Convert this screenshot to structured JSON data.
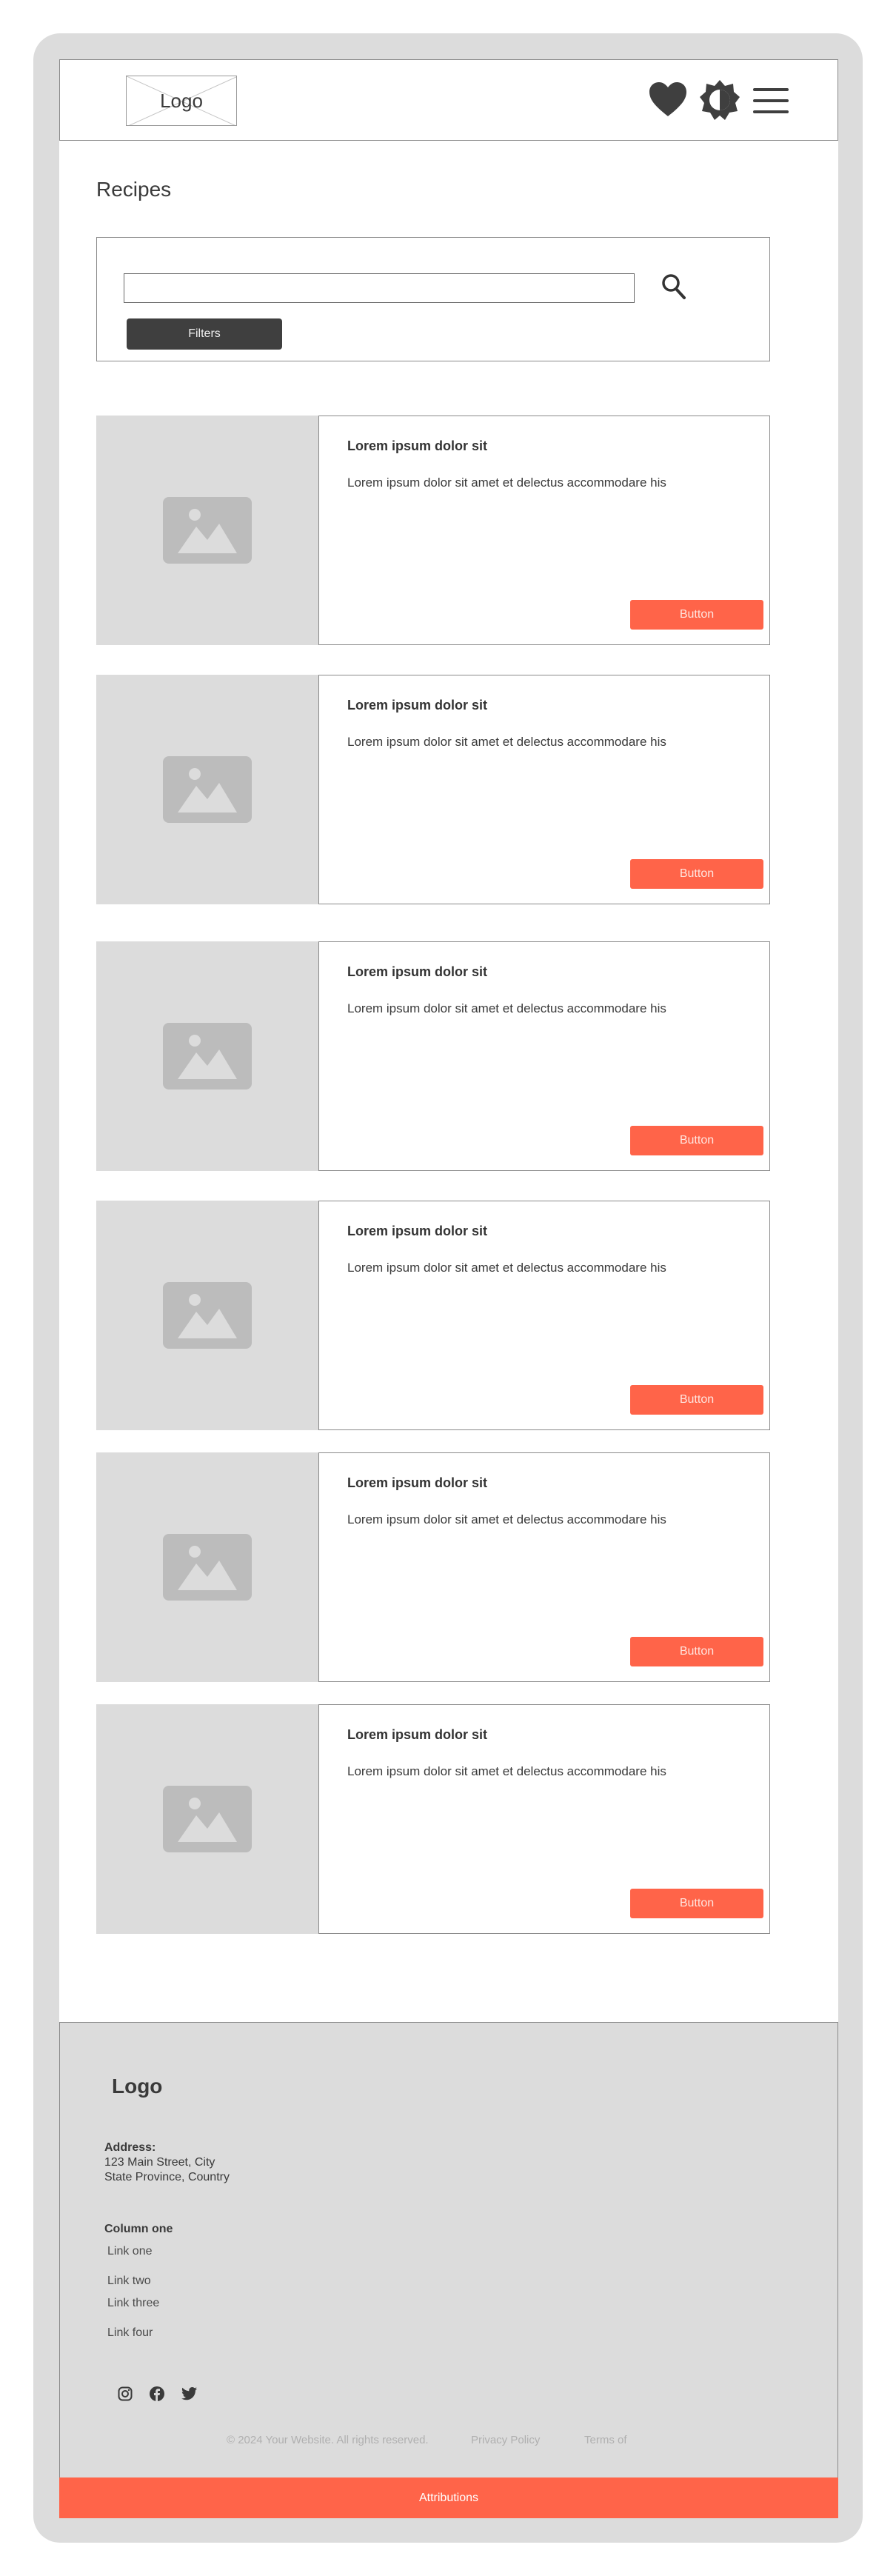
{
  "header": {
    "logo": "Logo",
    "icons": [
      "heart-icon",
      "theme-toggle-icon",
      "menu-icon"
    ]
  },
  "main": {
    "title": "Recipes",
    "search": {
      "value": "",
      "placeholder": ""
    },
    "filters_label": "Filters",
    "cards": [
      {
        "title": "Lorem ipsum dolor sit",
        "text": "Lorem ipsum dolor sit amet et delectus accommodare his",
        "button": "Button"
      },
      {
        "title": "Lorem ipsum dolor sit",
        "text": "Lorem ipsum dolor sit amet et delectus accommodare his",
        "button": "Button"
      },
      {
        "title": "Lorem ipsum dolor sit",
        "text": "Lorem ipsum dolor sit amet et delectus accommodare his",
        "button": "Button"
      },
      {
        "title": "Lorem ipsum dolor sit",
        "text": "Lorem ipsum dolor sit amet et delectus accommodare his",
        "button": "Button"
      },
      {
        "title": "Lorem ipsum dolor sit",
        "text": "Lorem ipsum dolor sit amet et delectus accommodare his",
        "button": "Button"
      },
      {
        "title": "Lorem ipsum dolor sit",
        "text": "Lorem ipsum dolor sit amet et delectus accommodare his",
        "button": "Button"
      }
    ]
  },
  "footer": {
    "logo": "Logo",
    "address_label": "Address:",
    "address_line1": "123 Main Street, City",
    "address_line2": "State Province, Country",
    "column_title": "Column one",
    "links": [
      "Link one",
      "Link two",
      "Link three",
      "Link four"
    ],
    "social": [
      "instagram-icon",
      "facebook-icon",
      "twitter-icon"
    ],
    "copyright": "© 2024 Your Website. All rights reserved.",
    "privacy": "Privacy Policy",
    "terms": "Terms of",
    "attributions": "Attributions"
  },
  "colors": {
    "accent": "#ff6449",
    "frame": "#dcdcdc",
    "dark": "#3f3f3f"
  }
}
